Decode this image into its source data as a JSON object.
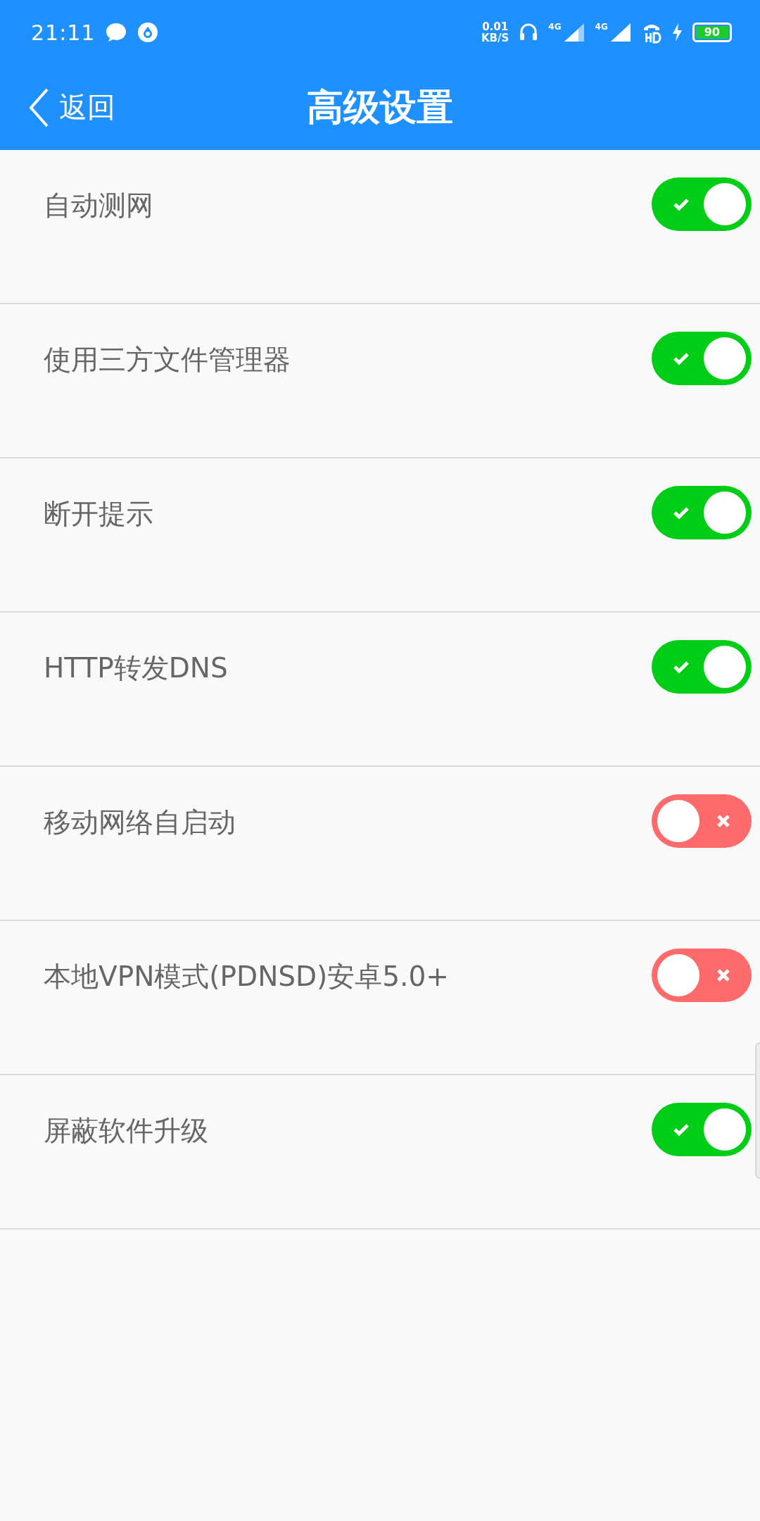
{
  "status_bar": {
    "time": "21:11",
    "net_speed_value": "0.01",
    "net_speed_unit": "KB/S",
    "sim1": "4G",
    "sim2": "4G",
    "battery": "90"
  },
  "header": {
    "back": "返回",
    "title": "高级设置"
  },
  "settings": [
    {
      "label": "自动测网",
      "on": true
    },
    {
      "label": "使用三方文件管理器",
      "on": true
    },
    {
      "label": "断开提示",
      "on": true
    },
    {
      "label": "HTTP转发DNS",
      "on": true
    },
    {
      "label": "移动网络自启动",
      "on": false
    },
    {
      "label": "本地VPN模式(PDNSD)安卓5.0+",
      "on": false
    },
    {
      "label": "屏蔽软件升级",
      "on": true
    }
  ]
}
